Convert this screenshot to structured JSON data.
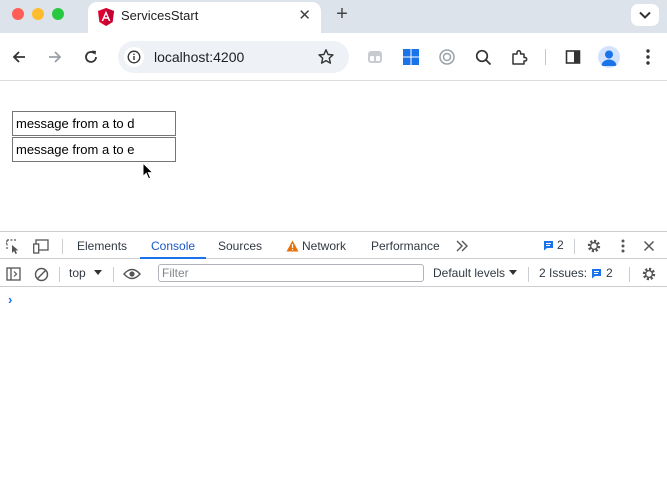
{
  "browser": {
    "tab_title": "ServicesStart",
    "tab_close_icon": "close-icon",
    "new_tab_icon": "plus-icon",
    "url": "localhost:4200"
  },
  "page": {
    "input1_value": "message from a to d",
    "input2_value": "message from a to e"
  },
  "devtools": {
    "tabs": [
      "Elements",
      "Console",
      "Sources",
      "Network",
      "Performance"
    ],
    "active_tab": "Console",
    "messages_count": "2",
    "context": "top",
    "filter_placeholder": "Filter",
    "levels": "Default levels",
    "issues_label": "2 Issues:",
    "issues_count": "2",
    "prompt": "›"
  },
  "colors": {
    "accent": "#1a73e8",
    "warning": "#e8710a",
    "angular": "#dd0031"
  }
}
